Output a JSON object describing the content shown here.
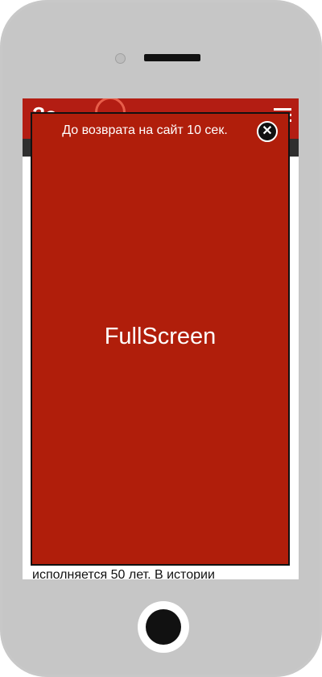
{
  "site": {
    "logo_text": "За",
    "menu_icon": "hamburger-icon",
    "article_snippet": "исполняется 50 лет. В истории"
  },
  "overlay": {
    "countdown_text": "До возврата на сайт 10 сек.",
    "close_icon": "close-icon",
    "close_glyph": "✕",
    "ad_label": "FullScreen",
    "background_color": "#b01e0b"
  }
}
